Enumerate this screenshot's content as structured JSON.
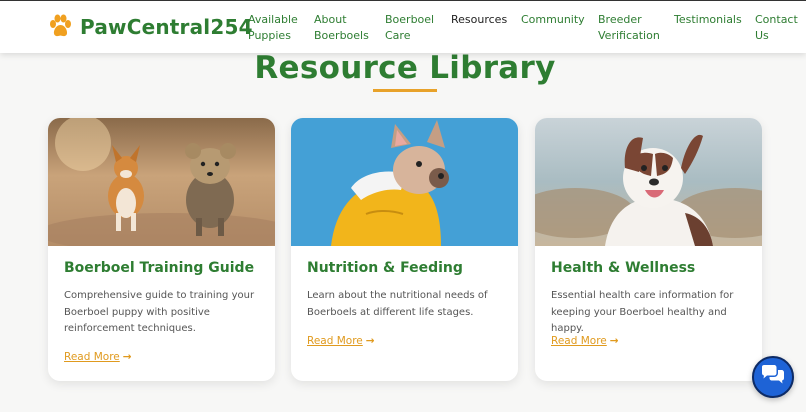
{
  "brand": {
    "name": "PawCentral254",
    "accent": "#f0a020"
  },
  "nav": {
    "items": [
      "Available\nPuppies",
      "About\nBoerboels",
      "Boerboel\nCare",
      "Resources",
      "Community",
      "Breeder\nVerification",
      "Testimonials",
      "Contact\nUs"
    ],
    "active_index": 3
  },
  "section": {
    "title": "Resource Library",
    "underline_color": "#e8a22a"
  },
  "cards": [
    {
      "title": "Boerboel Training Guide",
      "description": "Comprehensive guide to training your Boerboel puppy with positive reinforcement techniques.",
      "link": "Read More"
    },
    {
      "title": "Nutrition & Feeding",
      "description": "Learn about the nutritional needs of Boerboels at different life stages.",
      "link": "Read More"
    },
    {
      "title": "Health & Wellness",
      "description": "Essential health care information for keeping your Boerboel healthy and happy.",
      "link": "Read More"
    }
  ],
  "colors": {
    "primary_green": "#2e7d32",
    "link_orange": "#e09a1e",
    "chat_blue": "#1e63d6"
  },
  "chat": {
    "icon": "chat-bubbles-icon"
  }
}
